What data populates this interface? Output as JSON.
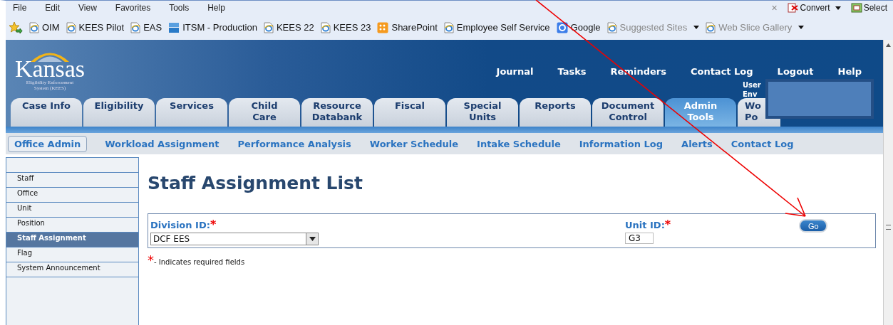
{
  "menu_bar": [
    "File",
    "Edit",
    "View",
    "Favorites",
    "Tools",
    "Help"
  ],
  "command_bar": [
    {
      "kind": "close",
      "label": "×"
    },
    {
      "kind": "convert",
      "label": "Convert",
      "dropdown": true
    },
    {
      "kind": "select",
      "label": "Select",
      "dropdown": false
    }
  ],
  "favorites_bar": [
    {
      "kind": "ie",
      "label": "OIM",
      "dimmed": false,
      "dropdown": false
    },
    {
      "kind": "ie",
      "label": "KEES Pilot",
      "dimmed": false,
      "dropdown": false
    },
    {
      "kind": "ie",
      "label": "EAS",
      "dimmed": false,
      "dropdown": false
    },
    {
      "kind": "itsm",
      "label": "ITSM - Production",
      "dimmed": false,
      "dropdown": false
    },
    {
      "kind": "ie",
      "label": "KEES 22",
      "dimmed": false,
      "dropdown": false
    },
    {
      "kind": "ie",
      "label": "KEES 23",
      "dimmed": false,
      "dropdown": false
    },
    {
      "kind": "sharepoint",
      "label": "SharePoint",
      "dimmed": false,
      "dropdown": false
    },
    {
      "kind": "ie",
      "label": "Employee Self Service",
      "dimmed": false,
      "dropdown": false
    },
    {
      "kind": "google",
      "label": "Google",
      "dimmed": false,
      "dropdown": false
    },
    {
      "kind": "ie",
      "label": "Suggested Sites",
      "dimmed": true,
      "dropdown": true
    },
    {
      "kind": "ie",
      "label": "Web Slice Gallery",
      "dimmed": true,
      "dropdown": true
    }
  ],
  "logo": {
    "title": "Kansas",
    "subtitle": "Eligibility Enforcement System (KEES)"
  },
  "top_links": [
    "Journal",
    "Tasks",
    "Reminders",
    "Contact Log",
    "Logout",
    "Help"
  ],
  "user_labels": [
    "User",
    "Env"
  ],
  "tabs": [
    {
      "label": "Case Info",
      "selected": false
    },
    {
      "label": "Eligibility",
      "selected": false
    },
    {
      "label": "Services",
      "selected": false
    },
    {
      "label": "Child\nCare",
      "selected": false
    },
    {
      "label": "Resource\nDatabank",
      "selected": false
    },
    {
      "label": "Fiscal",
      "selected": false
    },
    {
      "label": "Special\nUnits",
      "selected": false
    },
    {
      "label": "Reports",
      "selected": false
    },
    {
      "label": "Document\nControl",
      "selected": false
    },
    {
      "label": "Admin\nTools",
      "selected": true
    },
    {
      "label": "Wo\nPo",
      "selected": false
    }
  ],
  "subnav": [
    {
      "label": "Office Admin",
      "selected": true
    },
    {
      "label": "Workload Assignment",
      "selected": false
    },
    {
      "label": "Performance Analysis",
      "selected": false
    },
    {
      "label": "Worker Schedule",
      "selected": false
    },
    {
      "label": "Intake Schedule",
      "selected": false
    },
    {
      "label": "Information Log",
      "selected": false
    },
    {
      "label": "Alerts",
      "selected": false
    },
    {
      "label": "Contact Log",
      "selected": false
    }
  ],
  "sidebar": [
    {
      "label": "Staff",
      "selected": false
    },
    {
      "label": "Office",
      "selected": false
    },
    {
      "label": "Unit",
      "selected": false
    },
    {
      "label": "Position",
      "selected": false
    },
    {
      "label": "Staff Assignment",
      "selected": true
    },
    {
      "label": "Flag",
      "selected": false
    },
    {
      "label": "System Announcement",
      "selected": false
    }
  ],
  "page_title": "Staff Assignment List",
  "form": {
    "division": {
      "label": "Division ID:",
      "required": "*",
      "value": "DCF EES"
    },
    "unit": {
      "label": "Unit ID:",
      "required": "*",
      "value": "G3"
    },
    "go_button": "Go"
  },
  "required_note": {
    "mark": "*",
    "text": "- Indicates required fields"
  }
}
